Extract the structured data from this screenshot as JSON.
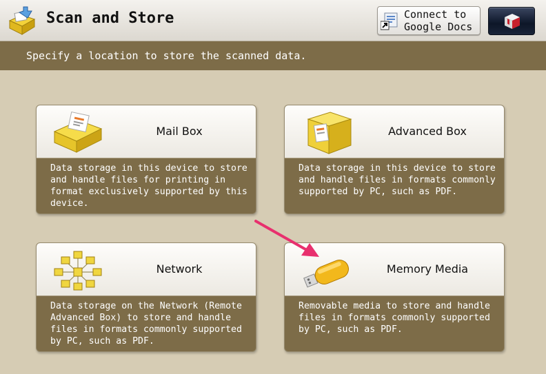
{
  "header": {
    "title": "Scan and Store",
    "app_icon": "scan-store-icon",
    "connect_button": {
      "label_line1": "Connect to",
      "label_line2": "Google Docs",
      "icon": "google-docs-connect-icon"
    },
    "menu_button": {
      "icon": "main-menu-cube-icon"
    }
  },
  "instruction": "Specify a location to store the scanned data.",
  "options": [
    {
      "id": "mail-box",
      "title": "Mail Box",
      "icon": "mail-box-tray-icon",
      "description": "Data storage in this device to store and handle files for printing in format exclusively supported by this device."
    },
    {
      "id": "advanced-box",
      "title": "Advanced Box",
      "icon": "advanced-box-cube-icon",
      "description": "Data storage in this device to store and handle files in formats commonly supported by PC, such as PDF."
    },
    {
      "id": "network",
      "title": "Network",
      "icon": "network-boxes-icon",
      "description": "Data storage on the Network (Remote Advanced Box) to store and handle files in formats commonly supported by PC, such as PDF."
    },
    {
      "id": "memory-media",
      "title": "Memory Media",
      "icon": "usb-memory-icon",
      "description": "Removable media to store and handle files in formats commonly supported by PC, such as PDF."
    }
  ],
  "annotation": {
    "arrow_color": "#e8306e",
    "points_to": "memory-media"
  },
  "colors": {
    "background": "#d6ccb4",
    "band": "#7d6c48",
    "card_text": "#ffffff"
  }
}
